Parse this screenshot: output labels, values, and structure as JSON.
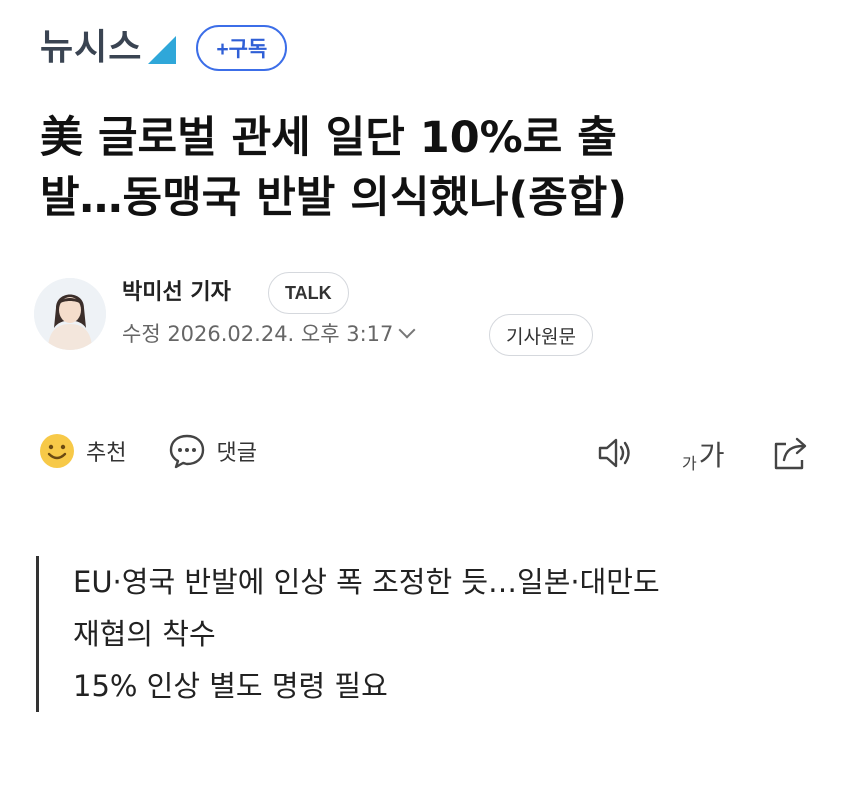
{
  "brand": {
    "logo_text": "뉴시스",
    "accent_color": "#2fa7d9",
    "subscribe_label": "+구독"
  },
  "headline": {
    "line1": "美 글로벌 관세 일단 10%로 출",
    "line2": "발…동맹국 반발 의식했나(종합)"
  },
  "author": {
    "avatar_icon": "reporter-avatar",
    "name": "박미선 기자",
    "talk_label": "TALK",
    "modified": "수정 2026.02.24. 오후 3:17",
    "source_label": "기사원문"
  },
  "actions": {
    "recommend_icon": "smile-icon",
    "recommend_label": "추천",
    "comment_icon": "comment-icon",
    "comment_label": "댓글",
    "audio_icon": "speaker-icon",
    "fontsize_small": "가",
    "fontsize_big": "가",
    "share_icon": "share-icon"
  },
  "summary": [
    "EU·영국 반발에 인상 폭 조정한 듯…일본·대만도",
    "재협의 착수",
    "15% 인상 별도 명령 필요"
  ]
}
